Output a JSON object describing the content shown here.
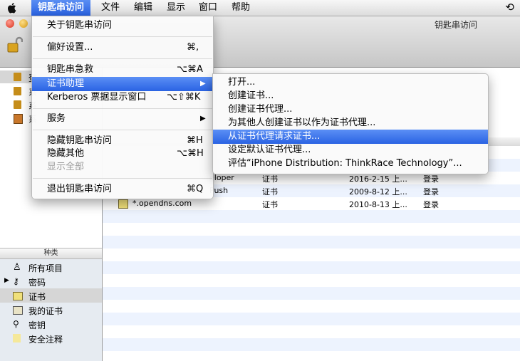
{
  "menubar": {
    "items": [
      "钥匙串访问",
      "文件",
      "编辑",
      "显示",
      "窗口",
      "帮助"
    ]
  },
  "window": {
    "title": "钥匙串访问"
  },
  "app_menu": {
    "items": [
      {
        "label": "关于钥匙串访问",
        "shortcut": ""
      },
      {
        "label": "偏好设置...",
        "shortcut": "⌘,"
      },
      {
        "label": "钥匙串急救",
        "shortcut": "⌥⌘A"
      },
      {
        "label": "证书助理",
        "shortcut": "▶"
      },
      {
        "label": "Kerberos 票据显示窗口",
        "shortcut": "⌥⇧⌘K"
      },
      {
        "label": "服务",
        "shortcut": "▶"
      },
      {
        "label": "隐藏钥匙串访问",
        "shortcut": "⌘H"
      },
      {
        "label": "隐藏其他",
        "shortcut": "⌥⌘H"
      },
      {
        "label": "显示全部",
        "shortcut": ""
      },
      {
        "label": "退出钥匙串访问",
        "shortcut": "⌘Q"
      }
    ]
  },
  "cert_submenu": {
    "items": [
      "打开...",
      "创建证书...",
      "创建证书代理...",
      "为其他人创建证书以作为证书代理...",
      "从证书代理请求证书...",
      "设定默认证书代理...",
      "评估“iPhone Distribution: ThinkRace Technology”..."
    ]
  },
  "sidebar": {
    "keychains": [
      "登",
      "系",
      "系",
      "系"
    ],
    "category_header": "种类",
    "categories": [
      "所有项目",
      "密码",
      "证书",
      "我的证书",
      "密钥",
      "安全注释"
    ]
  },
  "list": {
    "rows": [
      {
        "name": "eloper",
        "kind": "证书",
        "date": "2016-2-15 上...",
        "keychain": "登录"
      },
      {
        "name": "Push",
        "kind": "证书",
        "date": "2009-8-12 上...",
        "keychain": "登录"
      },
      {
        "name": "*.opendns.com",
        "kind": "证书",
        "date": "2010-8-13 上...",
        "keychain": "登录"
      }
    ]
  },
  "colors": {
    "highlight": "#2a63e3",
    "row_alt": "#edf3fe"
  }
}
